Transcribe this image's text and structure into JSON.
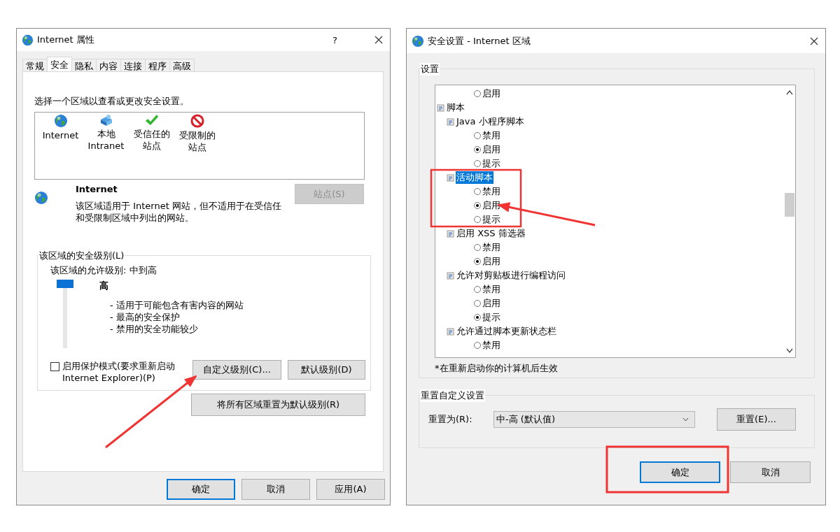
{
  "internet_options": {
    "window": {
      "title": "Internet 属性",
      "help": "?"
    },
    "tabs": [
      {
        "label": "常规",
        "selected": false
      },
      {
        "label": "安全",
        "selected": true
      },
      {
        "label": "隐私",
        "selected": false
      },
      {
        "label": "内容",
        "selected": false
      },
      {
        "label": "连接",
        "selected": false
      },
      {
        "label": "程序",
        "selected": false
      },
      {
        "label": "高级",
        "selected": false
      }
    ],
    "zone_prompt": "选择一个区域以查看或更改安全设置。",
    "zones": [
      {
        "kind": "globe",
        "lines": [
          "Internet"
        ]
      },
      {
        "kind": "intranet",
        "lines": [
          "本地",
          "Intranet"
        ]
      },
      {
        "kind": "trusted",
        "lines": [
          "受信任的",
          "站点"
        ]
      },
      {
        "kind": "restricted",
        "lines": [
          "受限制的",
          "站点"
        ]
      }
    ],
    "zone_info": {
      "kind": "globe",
      "name": "Internet",
      "description": "该区域适用于 Internet 网站，但不适用于在受信任和受限制区域中列出的网站。",
      "sites_button": {
        "label": "站点(S)",
        "disabled": true
      }
    },
    "security_level": {
      "title": "该区域的安全级别(L)",
      "allowed": "该区域的允许级别: 中到高",
      "slider": {
        "level": 1
      },
      "level_name": "高",
      "bullets": [
        "- 适用于可能包含有害内容的网站",
        "- 最高的安全保护",
        "- 禁用的安全功能较少"
      ],
      "protected_mode": {
        "label": "启用保护模式(要求重新启动\nInternet Explorer)(P)",
        "checked": false
      },
      "custom_button": "自定义级别(C)...",
      "default_button": "默认级别(D)"
    },
    "reset_all_button": "将所有区域重置为默认级别(R)",
    "buttons": [
      {
        "label": "确定",
        "default": true
      },
      {
        "label": "取消",
        "default": false
      },
      {
        "label": "应用(A)",
        "default": false
      }
    ]
  },
  "security_settings": {
    "window": {
      "title": "安全设置 - Internet 区域"
    },
    "settings_title": "设置",
    "settings_list": [
      {
        "kind": "option",
        "label": "启用",
        "checked": false
      },
      {
        "kind": "group",
        "label": "脚本",
        "selected": false,
        "children": [
          {
            "kind": "group",
            "label": "Java 小程序脚本",
            "selected": false,
            "children": [
              {
                "kind": "option",
                "label": "禁用",
                "checked": false
              },
              {
                "kind": "option",
                "label": "启用",
                "checked": true
              },
              {
                "kind": "option",
                "label": "提示",
                "checked": false
              }
            ]
          },
          {
            "kind": "group",
            "label": "活动脚本",
            "selected": true,
            "children": [
              {
                "kind": "option",
                "label": "禁用",
                "checked": false
              },
              {
                "kind": "option",
                "label": "启用",
                "checked": true
              },
              {
                "kind": "option",
                "label": "提示",
                "checked": false
              }
            ]
          },
          {
            "kind": "group",
            "label": "启用 XSS 筛选器",
            "selected": false,
            "children": [
              {
                "kind": "option",
                "label": "禁用",
                "checked": false
              },
              {
                "kind": "option",
                "label": "启用",
                "checked": true
              }
            ]
          },
          {
            "kind": "group",
            "label": "允许对剪贴板进行编程访问",
            "selected": false,
            "children": [
              {
                "kind": "option",
                "label": "禁用",
                "checked": false
              },
              {
                "kind": "option",
                "label": "启用",
                "checked": false
              },
              {
                "kind": "option",
                "label": "提示",
                "checked": true
              }
            ]
          },
          {
            "kind": "group",
            "label": "允许通过脚本更新状态栏",
            "selected": false,
            "children": [
              {
                "kind": "option",
                "label": "禁用",
                "checked": false
              }
            ]
          }
        ]
      }
    ],
    "restart_note": "*在重新启动你的计算机后生效",
    "reset_section": {
      "title": "重置自定义设置",
      "label": "重置为(R):",
      "value": "中-高 (默认值)",
      "button": "重置(E)..."
    },
    "buttons": [
      {
        "label": "确定",
        "default": true
      },
      {
        "label": "取消",
        "default": false
      }
    ]
  }
}
